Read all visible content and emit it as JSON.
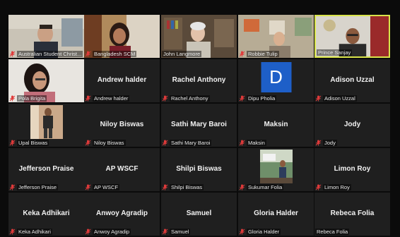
{
  "participants": [
    {
      "label": "Australian Student Christ...",
      "center": "",
      "muted": true
    },
    {
      "label": "Bangladesh SCM",
      "center": "",
      "muted": true
    },
    {
      "label": "John Langmore",
      "center": "",
      "muted": false
    },
    {
      "label": "Robbie Tulip",
      "center": "",
      "muted": true
    },
    {
      "label": "Prince Sanjay",
      "center": "",
      "muted": false,
      "active": true
    },
    {
      "label": "Pola Brigita",
      "center": "",
      "muted": true
    },
    {
      "label": "Andrew halder",
      "center": "Andrew halder",
      "muted": true
    },
    {
      "label": "Rachel Anthony",
      "center": "Rachel Anthony",
      "muted": true
    },
    {
      "label": "Dipu Pholia",
      "center": "",
      "muted": true,
      "avatar": "D"
    },
    {
      "label": "Adison Uzzal",
      "center": "Adison Uzzal",
      "muted": true
    },
    {
      "label": "Upal Biswas",
      "center": "",
      "muted": true
    },
    {
      "label": "Niloy Biswas",
      "center": "Niloy Biswas",
      "muted": true
    },
    {
      "label": "Sathi Mary Baroi",
      "center": "Sathi Mary Baroi",
      "muted": true
    },
    {
      "label": "Maksin",
      "center": "Maksin",
      "muted": true
    },
    {
      "label": "Jody",
      "center": "Jody",
      "muted": true
    },
    {
      "label": "Jefferson Praise",
      "center": "Jefferson Praise",
      "muted": true
    },
    {
      "label": "AP WSCF",
      "center": "AP WSCF",
      "muted": true
    },
    {
      "label": "Shilpi Biswas",
      "center": "Shilpi Biswas",
      "muted": true
    },
    {
      "label": "Sukumar Folia",
      "center": "",
      "muted": true
    },
    {
      "label": "Limon Roy",
      "center": "Limon Roy",
      "muted": true
    },
    {
      "label": "Keka Adhikari",
      "center": "Keka Adhikari",
      "muted": true
    },
    {
      "label": "Anwoy Agradip",
      "center": "Anwoy Agradip",
      "muted": true
    },
    {
      "label": "Samuel",
      "center": "Samuel",
      "muted": true
    },
    {
      "label": "Gloria Halder",
      "center": "Gloria Halder",
      "muted": true
    },
    {
      "label": "Rebeca Folia",
      "center": "Rebeca Folia",
      "muted": false
    }
  ],
  "colors": {
    "active_border": "#d8e34a",
    "muted_icon": "#e03a3a",
    "avatar_bg": "#1e5fc8"
  }
}
